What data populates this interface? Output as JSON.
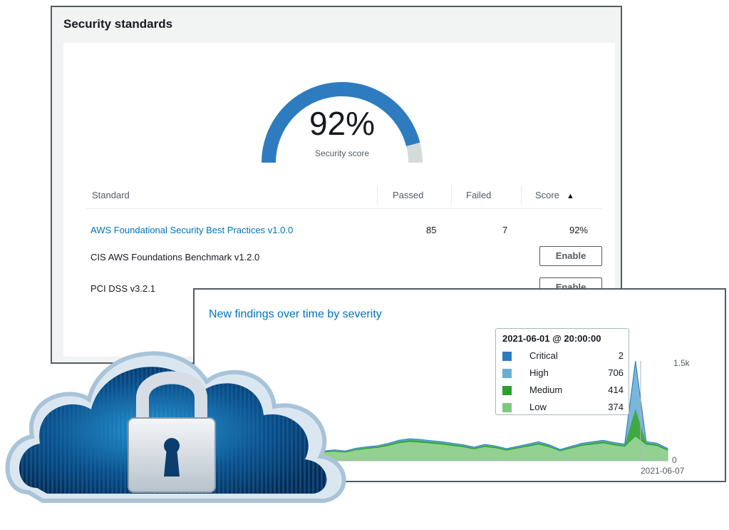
{
  "security_standards": {
    "title": "Security standards",
    "score_value": "92%",
    "score_fraction": 0.92,
    "score_label": "Security score",
    "table": {
      "columns": [
        "Standard",
        "Passed",
        "Failed",
        "Score"
      ],
      "rows": [
        {
          "standard": "AWS Foundational Security Best Practices v1.0.0",
          "passed": "85",
          "failed": "7",
          "score": "92%",
          "enabled": true
        },
        {
          "standard": "CIS AWS Foundations Benchmark v1.2.0",
          "button": "Enable",
          "enabled": false
        },
        {
          "standard": "PCI DSS v3.2.1",
          "button": "Enable",
          "enabled": false
        }
      ]
    }
  },
  "findings": {
    "title": "New findings over time by severity",
    "tooltip": {
      "title": "2021-06-01 @ 20:00:00",
      "rows": [
        {
          "name": "Critical",
          "value": "2",
          "color": "#2e7cbf"
        },
        {
          "name": "High",
          "value": "706",
          "color": "#6aaed6"
        },
        {
          "name": "Medium",
          "value": "414",
          "color": "#2ca02c"
        },
        {
          "name": "Low",
          "value": "374",
          "color": "#7fc97f"
        }
      ]
    },
    "y_tick_top": "1.5k",
    "y_tick_bottom": "0",
    "x_tick": "2021-06-07"
  },
  "chart_data": {
    "type": "area",
    "x_tick_labels": [
      "2021-06-07"
    ],
    "y_tick_labels": [
      "0",
      "1.5k"
    ],
    "ylim": [
      0,
      1500
    ],
    "series": [
      {
        "name": "Critical",
        "color": "#2e7cbf",
        "values": [
          0,
          0,
          0,
          0,
          0,
          0,
          0,
          0,
          0,
          0,
          0,
          0,
          0,
          0,
          0,
          0,
          0,
          0,
          0,
          0,
          0,
          0,
          0,
          0,
          0,
          0,
          0,
          0,
          0,
          0,
          0,
          0,
          0,
          0,
          0,
          0,
          0,
          0,
          0,
          0,
          0,
          2,
          0,
          0,
          0
        ]
      },
      {
        "name": "High",
        "color": "#6aaed6",
        "values": [
          5,
          5,
          5,
          4,
          5,
          6,
          5,
          4,
          4,
          6,
          7,
          6,
          5,
          6,
          5,
          7,
          8,
          8,
          9,
          12,
          13,
          13,
          12,
          12,
          11,
          10,
          8,
          10,
          9,
          7,
          8,
          10,
          12,
          9,
          6,
          8,
          10,
          11,
          12,
          11,
          10,
          706,
          14,
          12,
          10
        ]
      },
      {
        "name": "Medium",
        "color": "#2ca02c",
        "values": [
          10,
          12,
          11,
          9,
          12,
          13,
          11,
          8,
          10,
          14,
          16,
          15,
          12,
          13,
          12,
          15,
          17,
          19,
          22,
          26,
          28,
          27,
          25,
          24,
          22,
          20,
          17,
          21,
          19,
          15,
          18,
          21,
          24,
          20,
          14,
          18,
          22,
          24,
          26,
          23,
          21,
          414,
          24,
          22,
          16
        ]
      },
      {
        "name": "Low",
        "color": "#7fc97f",
        "values": [
          110,
          130,
          120,
          100,
          130,
          140,
          120,
          95,
          110,
          150,
          170,
          160,
          130,
          145,
          130,
          165,
          185,
          200,
          230,
          270,
          290,
          280,
          265,
          250,
          230,
          210,
          180,
          215,
          195,
          160,
          190,
          220,
          250,
          210,
          150,
          190,
          230,
          250,
          270,
          240,
          220,
          374,
          250,
          230,
          160
        ]
      }
    ]
  },
  "colors": {
    "gauge_fill": "#2e7cbf",
    "gauge_track": "#d5dbdb",
    "link": "#0073bb",
    "panel_border": "#545b64"
  },
  "icons": [
    "sort-ascending-icon",
    "cloud-lock-icon"
  ]
}
